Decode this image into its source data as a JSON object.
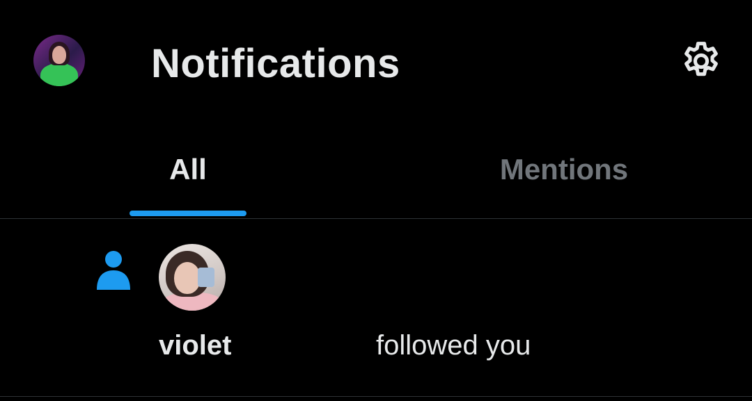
{
  "header": {
    "title": "Notifications",
    "profile_avatar": "avatar",
    "settings_icon": "gear-icon"
  },
  "tabs": [
    {
      "label": "All",
      "selected": true
    },
    {
      "label": "Mentions",
      "selected": false
    }
  ],
  "notifications": [
    {
      "type": "follow",
      "icon": "person-icon",
      "username": "violet",
      "action": "followed you"
    }
  ],
  "colors": {
    "background": "#000000",
    "text": "#e7e9ea",
    "muted": "#71767b",
    "accent": "#1d9bf0",
    "divider": "#2f3336"
  }
}
